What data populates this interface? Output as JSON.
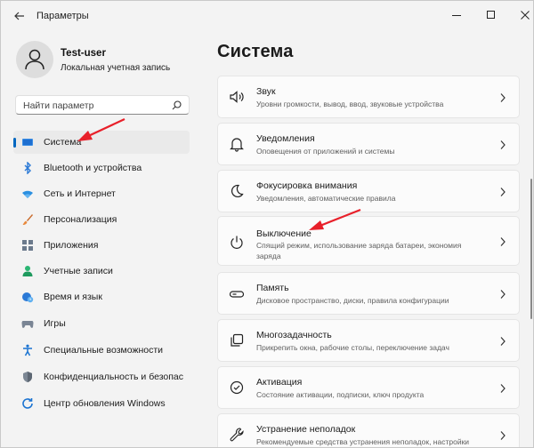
{
  "window": {
    "title": "Параметры"
  },
  "profile": {
    "name": "Test-user",
    "account_type": "Локальная учетная запись"
  },
  "search": {
    "placeholder": "Найти параметр"
  },
  "sidebar": {
    "items": [
      {
        "label": "Система",
        "icon": "display-icon",
        "selected": true
      },
      {
        "label": "Bluetooth и устройства",
        "icon": "bluetooth-icon"
      },
      {
        "label": "Сеть и Интернет",
        "icon": "wifi-icon"
      },
      {
        "label": "Персонализация",
        "icon": "brush-icon"
      },
      {
        "label": "Приложения",
        "icon": "apps-icon"
      },
      {
        "label": "Учетные записи",
        "icon": "person-icon"
      },
      {
        "label": "Время и язык",
        "icon": "globe-clock-icon"
      },
      {
        "label": "Игры",
        "icon": "gamepad-icon"
      },
      {
        "label": "Специальные возможности",
        "icon": "accessibility-icon"
      },
      {
        "label": "Конфиденциальность и безопас",
        "icon": "shield-icon"
      },
      {
        "label": "Центр обновления Windows",
        "icon": "update-icon"
      }
    ]
  },
  "main": {
    "title": "Система",
    "cards": [
      {
        "title": "Звук",
        "desc": "Уровни громкости, вывод, ввод, звуковые устройства",
        "icon": "speaker-icon"
      },
      {
        "title": "Уведомления",
        "desc": "Оповещения от приложений и системы",
        "icon": "bell-icon"
      },
      {
        "title": "Фокусировка внимания",
        "desc": "Уведомления, автоматические правила",
        "icon": "moon-icon"
      },
      {
        "title": "Выключение",
        "desc": "Спящий режим, использование заряда батареи, экономия заряда",
        "icon": "power-icon"
      },
      {
        "title": "Память",
        "desc": "Дисковое пространство, диски, правила конфигурации",
        "icon": "storage-icon"
      },
      {
        "title": "Многозадачность",
        "desc": "Прикрепить окна, рабочие столы, переключение задач",
        "icon": "multitask-icon"
      },
      {
        "title": "Активация",
        "desc": "Состояние активации, подписки, ключ продукта",
        "icon": "check-circle-icon"
      },
      {
        "title": "Устранение неполадок",
        "desc": "Рекомендуемые средства устранения неполадок, настройки",
        "icon": "wrench-icon"
      }
    ]
  },
  "colors": {
    "accent": "#0067c0",
    "annotation": "#e8202a"
  }
}
